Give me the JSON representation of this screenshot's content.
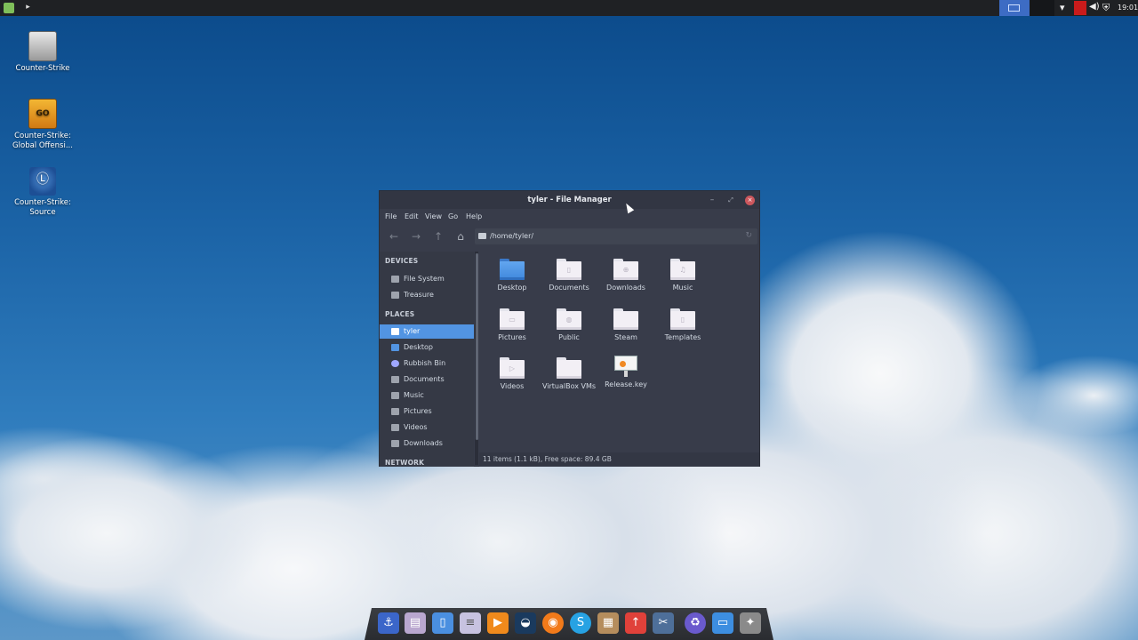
{
  "top_panel": {
    "menu_icon": "mint-menu-icon",
    "terminal_icon": "terminal-icon",
    "clock": "19:01",
    "tray_icons": [
      "workspace-switcher-icon",
      "wifi-icon",
      "red-indicator-icon",
      "volume-icon",
      "shield-icon"
    ]
  },
  "desktop": {
    "icons": [
      {
        "line1": "Counter-Strike",
        "line2": ""
      },
      {
        "line1": "Counter-Strike:",
        "line2": "Global Offensi..."
      },
      {
        "line1": "Counter-Strike:",
        "line2": "Source"
      }
    ],
    "csgo_logo_text": "GO"
  },
  "window": {
    "title": "tyler - File Manager",
    "menus": [
      "File",
      "Edit",
      "View",
      "Go",
      "Help"
    ],
    "path": "/home/tyler/",
    "sidebar": {
      "devices_header": "DEVICES",
      "devices": [
        "File System",
        "Treasure"
      ],
      "places_header": "PLACES",
      "places": [
        "tyler",
        "Desktop",
        "Rubbish Bin",
        "Documents",
        "Music",
        "Pictures",
        "Videos",
        "Downloads"
      ],
      "network_header": "NETWORK"
    },
    "files": [
      "Desktop",
      "Documents",
      "Downloads",
      "Music",
      "Pictures",
      "Public",
      "Steam",
      "Templates",
      "Videos",
      "VirtualBox VMs",
      "Release.key"
    ],
    "status": "11 items (1.1 kB), Free space: 89.4 GB"
  },
  "dock": {
    "items": [
      "anchor-icon",
      "files-icon",
      "document-icon",
      "text-editor-icon",
      "media-player-icon",
      "steam-icon",
      "firefox-icon",
      "skype-icon",
      "archive-icon",
      "upload-icon",
      "screenshot-icon",
      "recycle-icon",
      "display-icon",
      "counter-strike-icon"
    ]
  }
}
